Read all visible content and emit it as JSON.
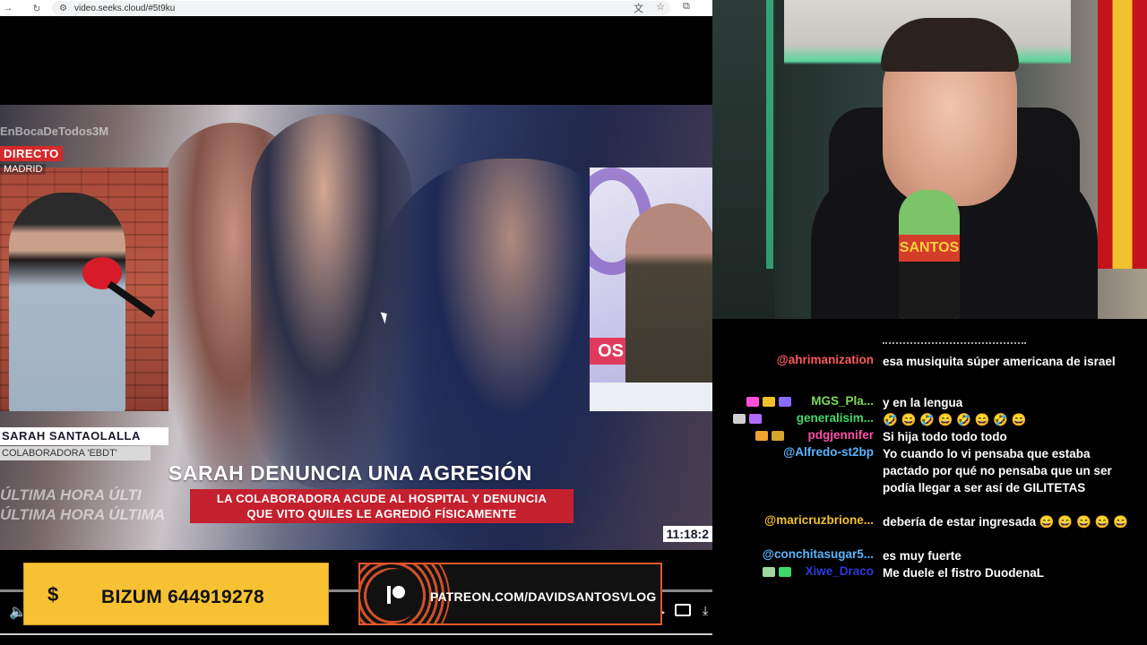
{
  "browser": {
    "url": "video.seeks.cloud/#5t9ku",
    "nav_forward": "→",
    "nav_reload": "↻",
    "translate_icon": "文",
    "star_icon": "☆",
    "extension_icon": "⧉",
    "tune_icon": "⚙"
  },
  "video": {
    "watermark": "EnBocaDeTodos3M",
    "live_badge": "DIRECTO",
    "location": "MADRID",
    "reporter_name": "SARAH SANTAOLALLA",
    "reporter_role": "COLABORADORA 'EBDT'",
    "headline": "SARAH DENUNCIA UNA AGRESIÓN",
    "subhead_line1": "LA COLABORADORA ACUDE AL HOSPITAL Y DENUNCIA",
    "subhead_line2": "QUE VITO QUILES LE AGREDIÓ FÍSICAMENTE",
    "ticker_line1": "ÚLTIMA HORA   ÚLTI",
    "ticker_line2": "ÚLTIMA HORA   ÚLTIMA",
    "clock": "11:18:2",
    "studio_text": "OS"
  },
  "overlays": {
    "bizum_symbol": "$",
    "bizum_label": "BIZUM 644919278",
    "patreon_label": "PATREON.COM/DAVIDSANTOSVLOG"
  },
  "controls": {
    "volume_icon": "🔈",
    "play_icon": "▸",
    "download_icon": "⤓"
  },
  "webcam": {
    "mic_brand": "SANTOS"
  },
  "chat": {
    "messages": [
      {
        "user": "@ahrimanization",
        "color": "#ff5a5a",
        "text": "esa musiquita súper americana de israel",
        "badges": []
      },
      {
        "user": "MGS_Pla...",
        "color": "#7ed957",
        "text": "y en la lengua",
        "badges": [
          "#ff4fd8",
          "#f2c12e",
          "#8a6cff"
        ]
      },
      {
        "user": "generalisim...",
        "color": "#3fd96b",
        "text": "🤣 😄 🤣 😄 🤣 😄 🤣 😄",
        "badges": [
          "#d0d0d0",
          "#b06cff"
        ]
      },
      {
        "user": "pdgjennifer",
        "color": "#ff4fa8",
        "text": "Si hija todo todo todo",
        "badges": [
          "#f2a12e",
          "#d4a72c"
        ]
      },
      {
        "user": "@Alfredo-st2bp",
        "color": "#5ab4ff",
        "text": "Yo cuando lo vi pensaba que estaba pactado por qué no pensaba que un ser podía llegar a ser así de GILITETAS",
        "badges": []
      },
      {
        "user": "@maricruzbrione...",
        "color": "#f2c12e",
        "text": "debería de estar ingresada 😄 😄 😄 😄 😄",
        "badges": []
      },
      {
        "user": "@conchitasugar5...",
        "color": "#5ab4ff",
        "text": "es muy fuerte",
        "badges": []
      },
      {
        "user": "Xiwe_Draco",
        "color": "#2e3bd9",
        "text": "Me duele el fistro DuodenaL",
        "badges": [
          "#9fd9a0",
          "#3fd96b"
        ]
      }
    ]
  }
}
